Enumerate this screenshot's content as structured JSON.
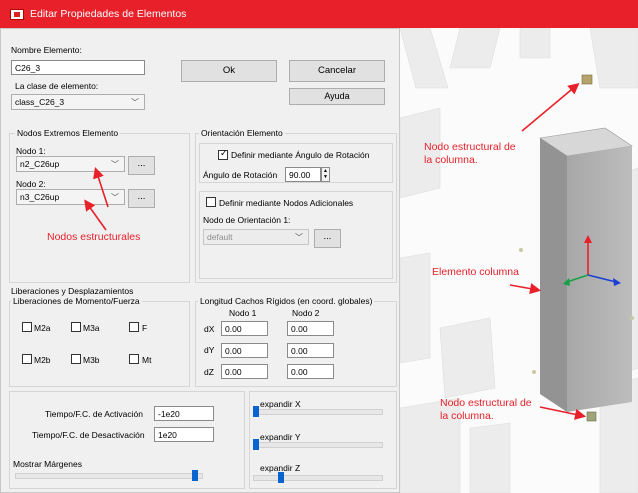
{
  "window": {
    "title": "Editar Propiedades de Elementos"
  },
  "top": {
    "nombre_label": "Nombre Elemento:",
    "nombre_value": "C26_3",
    "clase_label": "La clase de elemento:",
    "clase_value": "class_C26_3",
    "ok_label": "Ok",
    "cancel_label": "Cancelar",
    "help_label": "Ayuda"
  },
  "nodos": {
    "group_title": "Nodos Extremos Elemento",
    "nodo1_label": "Nodo 1:",
    "nodo1_value": "n2_C26up",
    "nodo2_label": "Nodo 2:",
    "nodo2_value": "n3_C26up",
    "browse_label": "...",
    "annotation": "Nodos estructurales"
  },
  "orientacion": {
    "group_title": "Orientación Elemento",
    "angulo_check_label": "Definir mediante Ángulo de Rotación",
    "angulo_check": true,
    "angulo_label": "Ángulo de Rotación",
    "angulo_value": "90.00",
    "nodos_check_label": "Definir mediante Nodos Adicionales",
    "nodos_check": false,
    "nodo_orient_label": "Nodo de Orientación 1:",
    "nodo_orient_value": "default",
    "browse_label": "..."
  },
  "liberaciones": {
    "outer_title": "Liberaciones y Desplazamientos",
    "group_title": "Liberaciones de Momento/Fuerza",
    "checks": [
      "M2a",
      "M3a",
      "F",
      "M2b",
      "M3b",
      "Mt"
    ]
  },
  "cachos": {
    "group_title": "Longitud Cachos Rígidos (en coord. globales)",
    "col1": "Nodo 1",
    "col2": "Nodo 2",
    "rows": [
      {
        "axis": "dX",
        "n1": "0.00",
        "n2": "0.00"
      },
      {
        "axis": "dY",
        "n1": "0.00",
        "n2": "0.00"
      },
      {
        "axis": "dZ",
        "n1": "0.00",
        "n2": "0.00"
      }
    ]
  },
  "bottom": {
    "activacion_label": "Tiempo/F.C. de Activación",
    "activacion_value": "-1e20",
    "desactivacion_label": "Tiempo/F.C. de Desactivación",
    "desactivacion_value": "1e20",
    "margenes_label": "Mostrar Márgenes",
    "margenes_level": 0.97,
    "expand_x_label": "expandir X",
    "expand_x_level": 0.0,
    "expand_y_label": "expandir Y",
    "expand_y_level": 0.0,
    "expand_z_label": "expandir Z",
    "expand_z_level": 0.2
  },
  "viewport": {
    "annot_nodo_top": "Nodo estructural de\nla columna.",
    "annot_elemento": "Elemento columna",
    "annot_nodo_bottom": "Nodo estructural de\nla columna."
  },
  "colors": {
    "title_bar": "#e8202a",
    "annotation": "#e8202a",
    "slider": "#0a64d0"
  }
}
